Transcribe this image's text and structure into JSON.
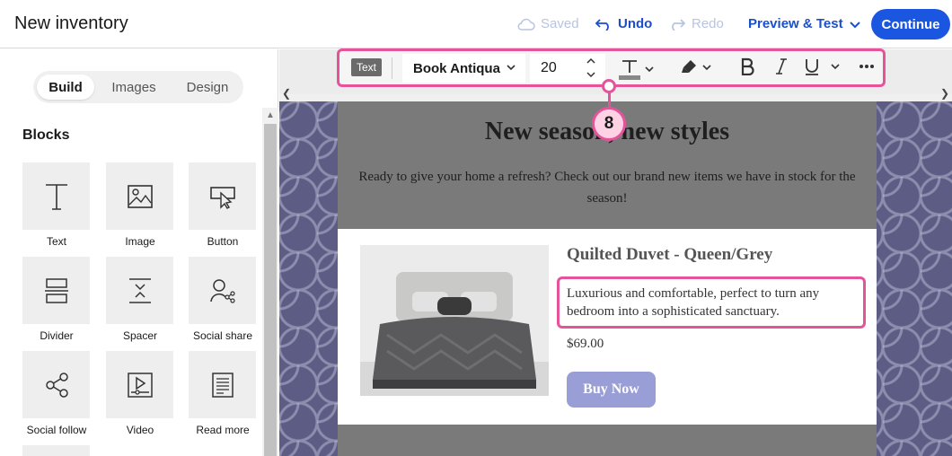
{
  "header": {
    "title": "New inventory",
    "saved_label": "Saved",
    "undo_label": "Undo",
    "redo_label": "Redo",
    "preview_label": "Preview & Test",
    "continue_label": "Continue"
  },
  "sidebar": {
    "tabs": [
      {
        "label": "Build",
        "active": true
      },
      {
        "label": "Images",
        "active": false
      },
      {
        "label": "Design",
        "active": false
      }
    ],
    "blocks_heading": "Blocks",
    "blocks": [
      {
        "label": "Text",
        "icon": "text-icon"
      },
      {
        "label": "Image",
        "icon": "image-icon"
      },
      {
        "label": "Button",
        "icon": "button-icon"
      },
      {
        "label": "Divider",
        "icon": "divider-icon"
      },
      {
        "label": "Spacer",
        "icon": "spacer-icon"
      },
      {
        "label": "Social share",
        "icon": "social-share-icon"
      },
      {
        "label": "Social follow",
        "icon": "social-follow-icon"
      },
      {
        "label": "Video",
        "icon": "video-icon"
      },
      {
        "label": "Read more",
        "icon": "read-more-icon"
      }
    ]
  },
  "toolbar": {
    "badge": "Text",
    "font": "Book Antiqua",
    "size": "20"
  },
  "callout": {
    "number": "8",
    "color": "#e5549b"
  },
  "email": {
    "headline": "New season, new styles",
    "intro": "Ready to give your home a refresh? Check out our brand new items we have in stock for the season!",
    "product": {
      "name": "Quilted Duvet - Queen/Grey",
      "description": "Luxurious and comfortable, perfect to turn any bedroom into a sophisticated sanctuary.",
      "price": "$69.00",
      "button": "Buy Now"
    }
  },
  "colors": {
    "accent": "#1a56e0",
    "button": "#9a9ed6",
    "highlight": "#e5549b"
  }
}
